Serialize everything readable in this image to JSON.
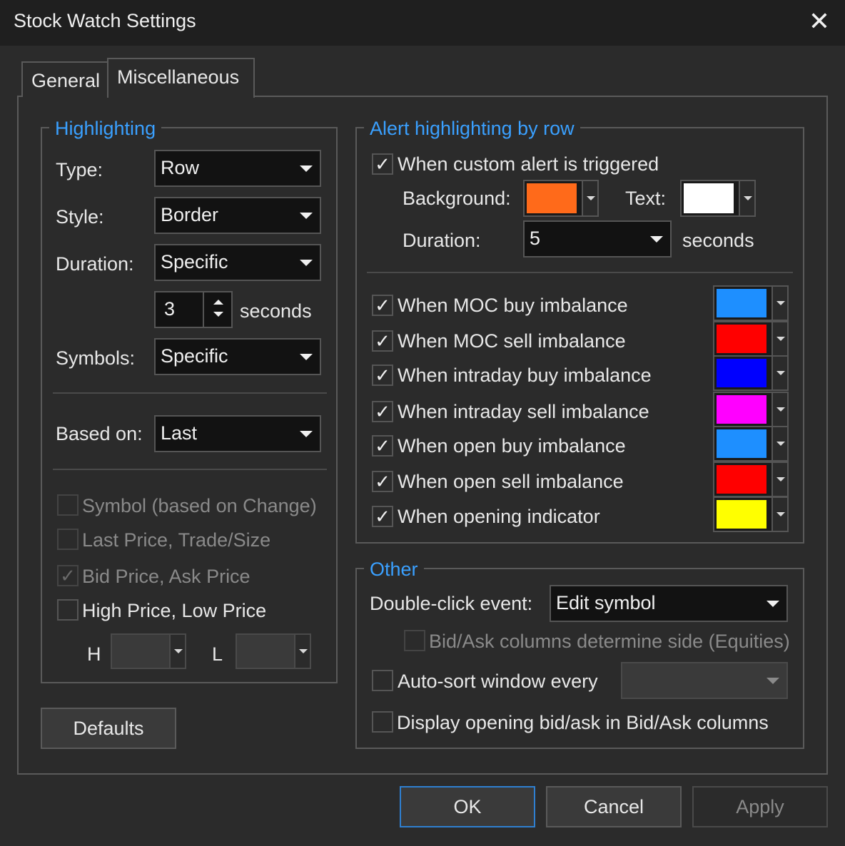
{
  "window": {
    "title": "Stock Watch Settings",
    "close": "✕"
  },
  "tabs": [
    {
      "label": "General"
    },
    {
      "label": "Miscellaneous"
    }
  ],
  "highlighting": {
    "legend": "Highlighting",
    "type_label": "Type:",
    "type_value": "Row",
    "style_label": "Style:",
    "style_value": "Border",
    "duration_label": "Duration:",
    "duration_value": "Specific",
    "seconds_value": "3",
    "seconds_label": "seconds",
    "symbols_label": "Symbols:",
    "symbols_value": "Specific",
    "based_on_label": "Based on:",
    "based_on_value": "Last",
    "cb_symbol": "Symbol (based on Change)",
    "cb_last": "Last Price, Trade/Size",
    "cb_bid": "Bid Price, Ask Price",
    "cb_high": "High Price, Low Price",
    "h_label": "H",
    "l_label": "L",
    "check_mark": "✓"
  },
  "alert": {
    "legend": "Alert highlighting by row",
    "custom_label": "When custom alert is triggered",
    "background_label": "Background:",
    "background_color": "#ff6a1a",
    "text_label": "Text:",
    "text_color": "#ffffff",
    "duration_label": "Duration:",
    "duration_value": "5",
    "seconds_label": "seconds",
    "rows": [
      {
        "label": "When MOC buy imbalance",
        "color": "#1e8fff"
      },
      {
        "label": "When MOC sell imbalance",
        "color": "#ff0000"
      },
      {
        "label": "When intraday buy imbalance",
        "color": "#0000ff"
      },
      {
        "label": "When intraday sell imbalance",
        "color": "#ff00ff"
      },
      {
        "label": "When open buy imbalance",
        "color": "#1e8fff"
      },
      {
        "label": "When open sell imbalance",
        "color": "#ff0000"
      },
      {
        "label": "When opening indicator",
        "color": "#ffff00"
      }
    ]
  },
  "other": {
    "legend": "Other",
    "dblclick_label": "Double-click event:",
    "dblclick_value": "Edit symbol",
    "bidask_side_label": "Bid/Ask columns determine side (Equities)",
    "autosort_label": "Auto-sort window every",
    "display_opening_label": "Display opening bid/ask in Bid/Ask columns"
  },
  "buttons": {
    "defaults": "Defaults",
    "ok": "OK",
    "cancel": "Cancel",
    "apply": "Apply"
  }
}
